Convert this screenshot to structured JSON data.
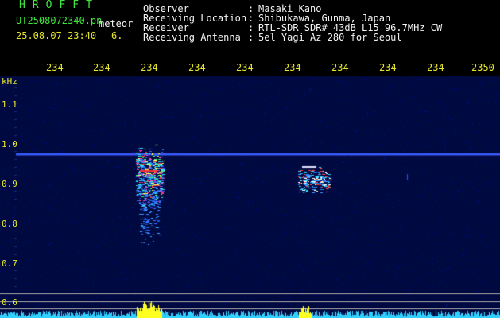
{
  "header": {
    "brand": "HROFFT",
    "filename": "UT2508072340.pn",
    "event_type": "meteor",
    "datetime": "25.08.07 23:40",
    "count": "6.",
    "fields": [
      {
        "label": "Observer",
        "value": "Masaki Kano"
      },
      {
        "label": "Receiving Location",
        "value": "Shibukawa, Gunma, Japan"
      },
      {
        "label": "Receiver",
        "value": "RTL-SDR SDR# 43dB L15 96.7MHz CW"
      },
      {
        "label": "Receiving Antenna",
        "value": "5el Yagi Az 280 for Seoul"
      }
    ]
  },
  "time_axis": {
    "ticks": [
      "234",
      "234",
      "234",
      "234",
      "234",
      "234",
      "234",
      "234",
      "234",
      "2350"
    ]
  },
  "freq_axis": {
    "unit": "kHz",
    "ticks": [
      "1.1",
      "1.0",
      "0.9",
      "0.8",
      "0.7",
      "0.6"
    ]
  },
  "colors": {
    "header_green": "#3ee63e",
    "label_white": "#f2f2f2",
    "axis_yellow": "#e6e62e",
    "background_blue": "#000a40",
    "carrier_line": "#3a5cff",
    "activity_cyan": "#30e0ff"
  }
}
